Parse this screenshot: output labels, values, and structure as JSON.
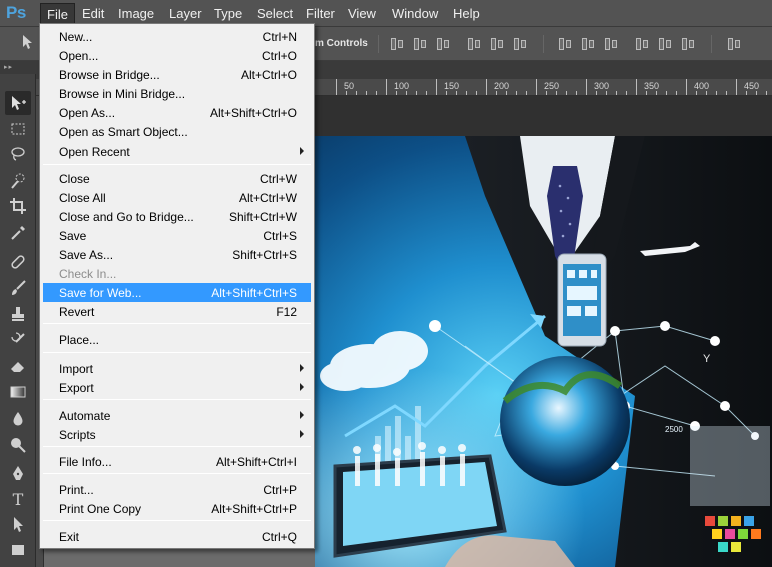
{
  "app": {
    "logo": "Ps"
  },
  "menubar": {
    "items": [
      "File",
      "Edit",
      "Image",
      "Layer",
      "Type",
      "Select",
      "Filter",
      "View",
      "Window",
      "Help"
    ]
  },
  "options_bar": {
    "transform_controls_label": "m Controls"
  },
  "ruler": {
    "labels": [
      "50",
      "100",
      "150",
      "200",
      "250",
      "300",
      "350",
      "400",
      "450"
    ]
  },
  "file_menu": {
    "items": [
      {
        "label": "New...",
        "shortcut": "Ctrl+N"
      },
      {
        "label": "Open...",
        "shortcut": "Ctrl+O"
      },
      {
        "label": "Browse in Bridge...",
        "shortcut": "Alt+Ctrl+O"
      },
      {
        "label": "Browse in Mini Bridge...",
        "shortcut": ""
      },
      {
        "label": "Open As...",
        "shortcut": "Alt+Shift+Ctrl+O"
      },
      {
        "label": "Open as Smart Object...",
        "shortcut": ""
      },
      {
        "label": "Open Recent",
        "shortcut": "",
        "submenu": true
      },
      {
        "label": "Close",
        "shortcut": "Ctrl+W"
      },
      {
        "label": "Close All",
        "shortcut": "Alt+Ctrl+W"
      },
      {
        "label": "Close and Go to Bridge...",
        "shortcut": "Shift+Ctrl+W"
      },
      {
        "label": "Save",
        "shortcut": "Ctrl+S"
      },
      {
        "label": "Save As...",
        "shortcut": "Shift+Ctrl+S"
      },
      {
        "label": "Check In...",
        "shortcut": "",
        "disabled": true
      },
      {
        "label": "Save for Web...",
        "shortcut": "Alt+Shift+Ctrl+S",
        "highlighted": true
      },
      {
        "label": "Revert",
        "shortcut": "F12"
      },
      {
        "label": "Place...",
        "shortcut": ""
      },
      {
        "label": "Import",
        "shortcut": "",
        "submenu": true
      },
      {
        "label": "Export",
        "shortcut": "",
        "submenu": true
      },
      {
        "label": "Automate",
        "shortcut": "",
        "submenu": true
      },
      {
        "label": "Scripts",
        "shortcut": "",
        "submenu": true
      },
      {
        "label": "File Info...",
        "shortcut": "Alt+Shift+Ctrl+I"
      },
      {
        "label": "Print...",
        "shortcut": "Ctrl+P"
      },
      {
        "label": "Print One Copy",
        "shortcut": "Alt+Shift+Ctrl+P"
      },
      {
        "label": "Exit",
        "shortcut": "Ctrl+Q"
      }
    ]
  },
  "image_text": {
    "screen_number": "2500",
    "phone_label": "Y"
  },
  "colors": {
    "highlight": "#3399ff",
    "menu_bg": "#f0f0f0",
    "ui_bg": "#535353",
    "logo": "#4ea3dd"
  }
}
